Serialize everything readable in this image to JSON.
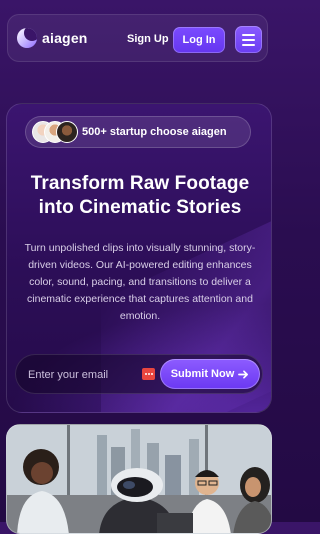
{
  "header": {
    "brand": "aiagen",
    "signup_label": "Sign Up",
    "login_label": "Log In",
    "menu_icon": "hamburger-menu-icon"
  },
  "hero": {
    "social_proof": "500+ startup choose aiagen",
    "headline_line1": "Transform Raw Footage",
    "headline_line2": "into Cinematic Stories",
    "description": "Turn unpolished clips into visually stunning, story-driven videos. Our AI-powered editing enhances color, sound, pacing, and transitions to deliver a cinematic experience that captures attention and emotion.",
    "email_placeholder": "Enter your email",
    "submit_label": "Submit Now",
    "submit_icon": "arrow-right-icon"
  },
  "colors": {
    "accent": "#7b4bff",
    "background": "#2a0d50"
  }
}
